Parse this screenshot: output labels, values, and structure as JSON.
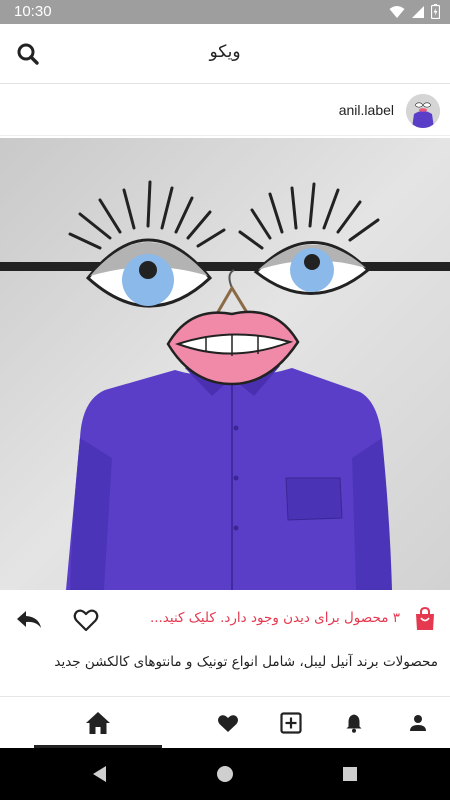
{
  "status_bar": {
    "time": "10:30"
  },
  "app_bar": {
    "title": "ویکو"
  },
  "post": {
    "username": "anil.label",
    "products_text": "۳ محصول برای دیدن وجود دارد. کلیک کنید...",
    "caption": "محصولات برند آنیل لیبل، شامل انواع تونیک و مانتوهای کالکشن جدید"
  },
  "icons": {
    "search": "search-icon",
    "bag": "shopping-bag-icon",
    "heart": "heart-outline-icon",
    "reply": "reply-icon",
    "nav_profile": "person-icon",
    "nav_notifications": "bell-icon",
    "nav_add": "add-box-icon",
    "nav_likes": "heart-icon",
    "nav_home": "home-icon"
  },
  "colors": {
    "accent": "#e53950",
    "status_bar": "#9e9e9e",
    "shirt": "#5a3ec8"
  }
}
